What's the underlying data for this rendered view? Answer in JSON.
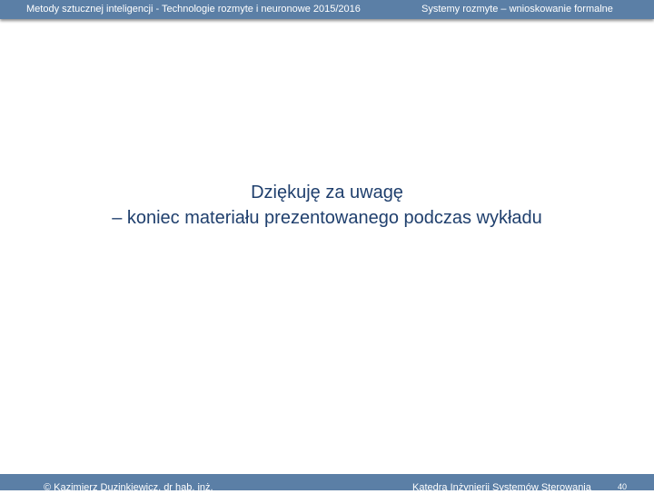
{
  "header": {
    "left_text": "Metody sztucznej inteligencji - Technologie rozmyte i neuronowe 2015/2016",
    "right_text": "Systemy rozmyte – wnioskowanie formalne"
  },
  "content": {
    "line1": "Dziękuję za uwagę",
    "line2": "– koniec materiału prezentowanego podczas wykładu"
  },
  "footer": {
    "left_text": "© Kazimierz Duzinkiewicz, dr hab. inż.",
    "right_text": "Katedra Inżynierii Systemów Sterowania",
    "page_number": "40"
  }
}
